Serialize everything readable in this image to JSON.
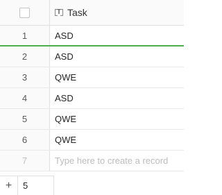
{
  "header": {
    "field_icon": "text-field-icon",
    "column_title": "Task"
  },
  "rows": [
    {
      "num": "1",
      "task": "ASD"
    },
    {
      "num": "2",
      "task": "ASD"
    },
    {
      "num": "3",
      "task": "QWE"
    },
    {
      "num": "4",
      "task": "ASD"
    },
    {
      "num": "5",
      "task": "QWE"
    },
    {
      "num": "6",
      "task": "QWE"
    }
  ],
  "new_row": {
    "num": "7",
    "placeholder": "Type here to create a record"
  },
  "footer": {
    "add_icon": "+",
    "record_count": "5"
  },
  "colors": {
    "active_underline": "#4caf50",
    "grid_line": "#e0e0e0"
  }
}
